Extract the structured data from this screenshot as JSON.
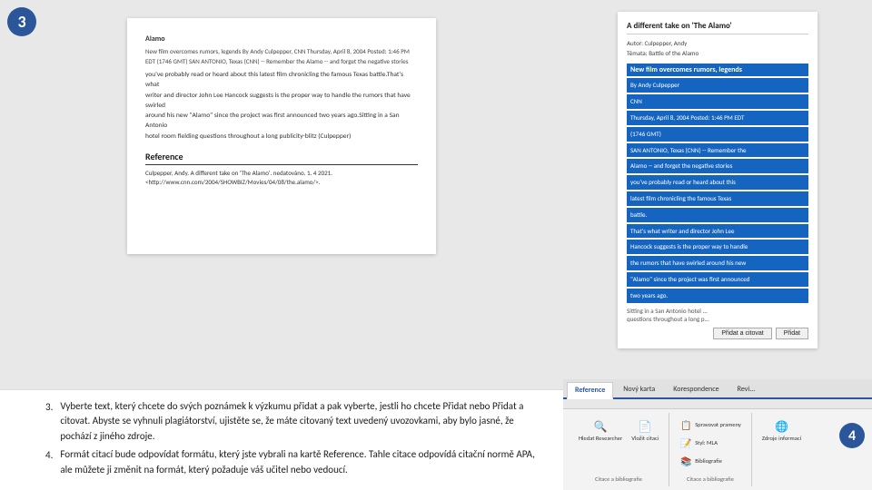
{
  "step3": {
    "badge": "3",
    "badge4": "4"
  },
  "document": {
    "title": "Alamo",
    "meta_line1": "New film overcomes rumors, legends By Andy Culpepper, CNN    Thursday, April 8, 2004 Posted: 1:46 PM",
    "meta_line2": "EDT (1746 GMT)   SAN ANTONIO, Texas (CNN) -- Remember the Alamo -- and forget the negative stories",
    "body1": "you've probably read or heard about this latest film chronicling the famous Texas battle.That's what",
    "body2": "writer and director John Lee Hancock suggests is the proper way to handle the rumors that have swirled",
    "body3": "around his new \"Alamo\" since the project was first announced two years ago.Sitting in a San Antonio",
    "body4": "hotel room fielding questions throughout a long publicity-blitz (Culpepper)",
    "reference_heading": "Reference",
    "reference_text1": "Culpepper, Andy. A different take on 'The Alamo'. nedatováno. 1. 4 2021.",
    "reference_text2": "<http://www.cnn.com/2004/SHOWBIZ/Movies/04/08/the.alamo/>."
  },
  "source_card": {
    "title": "A different take on 'The Alamo'",
    "autor_label": "Autor: Culpepper, Andy",
    "temata_label": "Témata: Battle of the Alamo",
    "article_heading": "New film overcomes rumors, legends",
    "byline1": "By Andy Culpepper",
    "byline2": "CNN",
    "byline3": "Thursday, April 8, 2004 Posted: 1:46 PM EDT",
    "byline4": "(1746 GMT)",
    "body1": "SAN ANTONIO, Texas (CNN) -- Remember the",
    "body2": "Alamo -- and forget the negative stories",
    "body3": "you've probably read or heard about this",
    "body4": "latest film chronicling the famous Texas",
    "body5": "battle.",
    "body6": "That's what writer and director John Lee",
    "body7": "Hancock suggests is the proper way to handle",
    "body8": "the rumors that have swirled around his new",
    "body9": "\"Alamo\" since the project was first announced",
    "body10": "two years ago.",
    "faded1": "Sitting in a San Antonio hotel ...",
    "faded2": "questions throughout a long p...",
    "add_cite_btn": "Přidat a citovat",
    "add_btn": "Přidat"
  },
  "instructions": {
    "item3_num": "3.",
    "item3_text": "Vyberte text, který chcete do svých poznámek k výzkumu přidat a pak vyberte, jestli ho chcete Přidat nebo Přidat a citovat. Abyste se vyhnuli plagiátorství, ujistěte se, že máte citovaný text uvedený uvozovkami, aby bylo jasné, že pochází z jiného zdroje.",
    "item4_num": "4.",
    "item4_text": "Formát citací bude odpovídat formátu, který jste vybrali na kartě Reference. Tahle citace odpovídá citační normě APA, ale můžete ji změnit na formát, který požaduje váš učitel nebo vedoucí."
  },
  "ribbon": {
    "tabs": [
      "Reference",
      "Nový karta",
      "Korespondence",
      "Revi..."
    ],
    "active_tab": "Reference",
    "group1_label": "Citace a bibliografie",
    "btn_hledat": "Hledat Researcher",
    "btn_vlozit": "Vložit citaci",
    "btn_spravit": "Spravovat prameny",
    "btn_styl": "Styl: MLA",
    "btn_bibliografie": "Bibliografie",
    "group2_label": "Citace a bibliografie",
    "btn_zdroje": "Zdroje informací"
  }
}
